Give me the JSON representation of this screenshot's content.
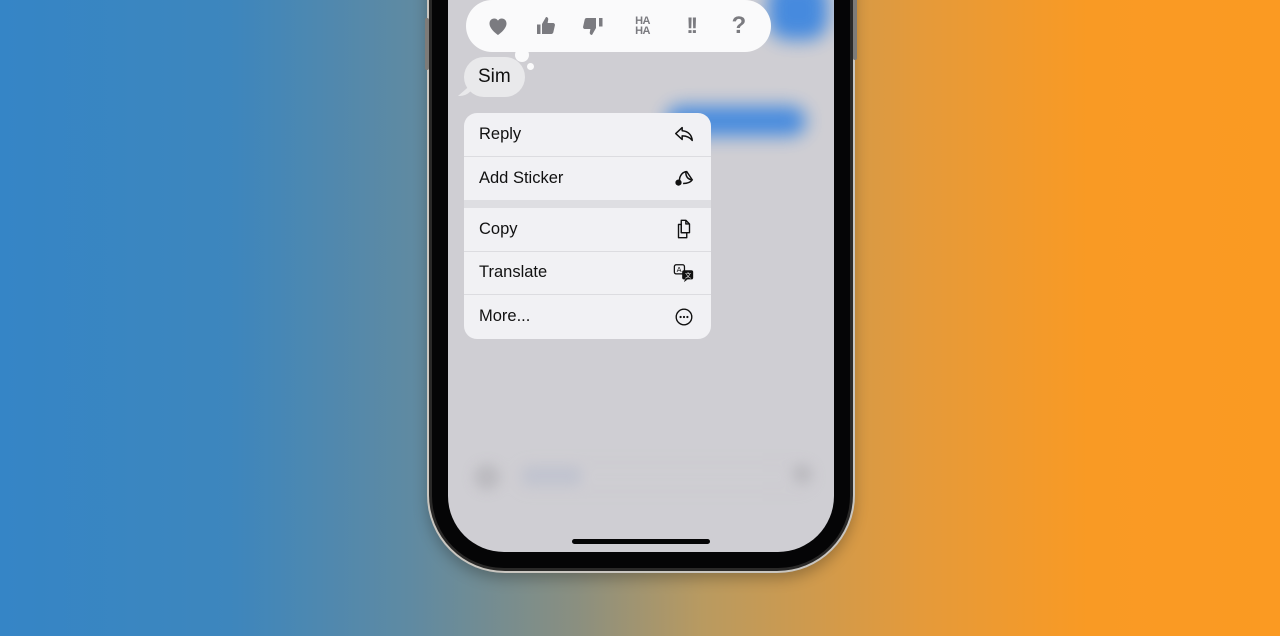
{
  "background": {
    "gradient_left": "#3585c6",
    "gradient_right": "#fb9a22"
  },
  "reactions": [
    {
      "name": "heart",
      "icon": "heart-icon"
    },
    {
      "name": "thumbs-up",
      "icon": "thumbs-up-icon"
    },
    {
      "name": "thumbs-down",
      "icon": "thumbs-down-icon"
    },
    {
      "name": "haha",
      "icon": "haha-icon",
      "text_top": "HA",
      "text_bottom": "HA"
    },
    {
      "name": "emphasize",
      "icon": "double-exclamation-icon",
      "text": "!!"
    },
    {
      "name": "question",
      "icon": "question-mark-icon",
      "text": "?"
    }
  ],
  "message": {
    "text": "Sim"
  },
  "menu": {
    "groups": [
      [
        {
          "label": "Reply",
          "icon": "reply-arrow-icon"
        },
        {
          "label": "Add Sticker",
          "icon": "sticker-icon"
        }
      ],
      [
        {
          "label": "Copy",
          "icon": "copy-documents-icon"
        },
        {
          "label": "Translate",
          "icon": "translate-icon"
        },
        {
          "label": "More...",
          "icon": "ellipsis-circle-icon"
        }
      ]
    ]
  }
}
